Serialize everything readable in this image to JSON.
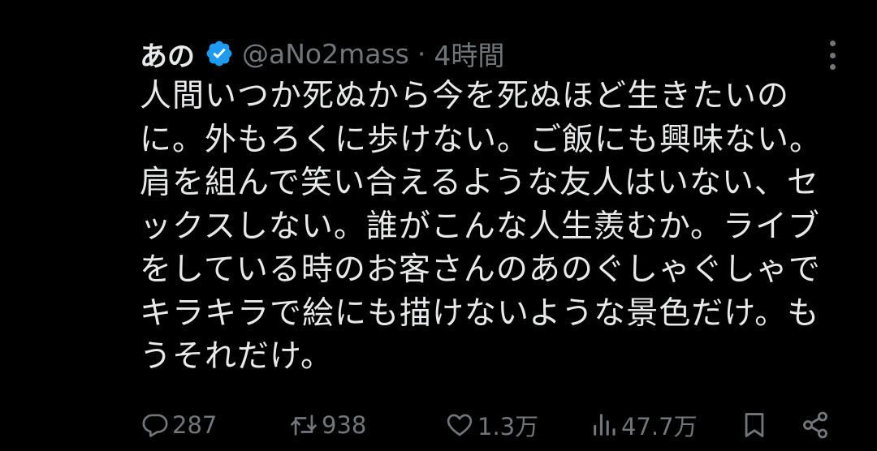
{
  "tweet": {
    "author_name": "あの",
    "handle": "@aNo2mass",
    "separator": "·",
    "timestamp": "4時間",
    "text_lines": [
      "人間いつか死ぬから今を死ぬほど生きたいの",
      "に。外もろくに歩けない。ご飯にも興味ない。",
      "肩を組んで笑い合えるような友人はいない、セ",
      "ックスしない。誰がこんな人生羨むか。ライブ",
      "をしている時のお客さんのあのぐしゃぐしゃで",
      "キラキラで絵にも描けないような景色だけ。も",
      "うそれだけ。"
    ]
  },
  "actions": {
    "replies": "287",
    "retweets": "938",
    "likes": "1.3万",
    "views": "47.7万"
  },
  "icons": {
    "verified": "verified-badge-icon",
    "more": "more-options-icon",
    "reply": "reply-icon",
    "retweet": "retweet-icon",
    "like": "heart-icon",
    "views": "views-bar-chart-icon",
    "bookmark": "bookmark-icon",
    "share": "share-icon"
  },
  "colors": {
    "background": "#000000",
    "text": "#e7e9ea",
    "muted": "#71767b",
    "verified": "#1d9bf0"
  }
}
